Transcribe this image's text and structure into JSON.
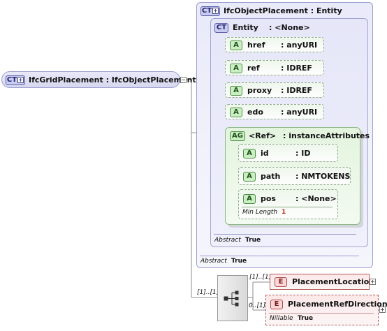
{
  "root": {
    "badge": "CT",
    "name": "IfcGridPlacement : IfcObjectPlacement"
  },
  "base": {
    "badge": "CT",
    "name": "IfcObjectPlacement : Entity",
    "abstract_label": "Abstract",
    "abstract_value": "True"
  },
  "entity": {
    "badge": "CT",
    "name": "Entity",
    "type": ": <None>",
    "abstract_label": "Abstract",
    "abstract_value": "True"
  },
  "attributes": [
    {
      "badge": "A",
      "name": "href",
      "type": ": anyURI"
    },
    {
      "badge": "A",
      "name": "ref",
      "type": ": IDREF"
    },
    {
      "badge": "A",
      "name": "proxy",
      "type": ": IDREF"
    },
    {
      "badge": "A",
      "name": "edo",
      "type": ": anyURI"
    }
  ],
  "group": {
    "badge": "AG",
    "name": "<Ref>",
    "type": ": instanceAttributes",
    "items": [
      {
        "badge": "A",
        "name": "id",
        "type": ": ID"
      },
      {
        "badge": "A",
        "name": "path",
        "type": ": NMTOKENS"
      },
      {
        "badge": "A",
        "name": "pos",
        "type": ": <None>",
        "facet_label": "Min Length",
        "facet_value": "1"
      }
    ]
  },
  "sequence": {
    "cardinality": "[1]..[1]"
  },
  "elements": [
    {
      "badge": "E",
      "name": "PlacementLocation",
      "cardinality": "[1]..[1]"
    },
    {
      "badge": "E",
      "name": "PlacementRefDirection",
      "cardinality": "0..[1]",
      "nillable_label": "Nillable",
      "nillable_value": "True"
    }
  ]
}
